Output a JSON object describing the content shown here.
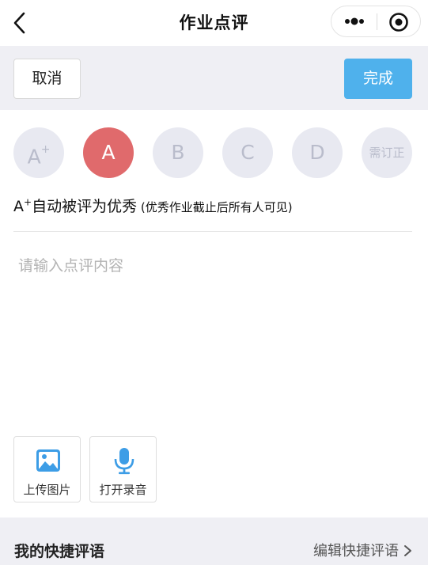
{
  "nav": {
    "title": "作业点评"
  },
  "actions": {
    "cancel_label": "取消",
    "done_label": "完成"
  },
  "grades": [
    {
      "label": "A",
      "sup": "+",
      "selected": false
    },
    {
      "label": "A",
      "sup": "",
      "selected": true
    },
    {
      "label": "B",
      "sup": "",
      "selected": false
    },
    {
      "label": "C",
      "sup": "",
      "selected": false
    },
    {
      "label": "D",
      "sup": "",
      "selected": false
    },
    {
      "label": "需订正",
      "sup": "",
      "selected": false
    }
  ],
  "note": {
    "prefix": "A",
    "prefix_sup": "+",
    "main": "自动被评为优秀",
    "sub": " (优秀作业截止后所有人可见)"
  },
  "comment": {
    "placeholder": "请输入点评内容",
    "value": ""
  },
  "tools": {
    "upload_label": "上传图片",
    "record_label": "打开录音"
  },
  "quick": {
    "title": "我的快捷评语",
    "edit_label": "编辑快捷评语"
  },
  "colors": {
    "primary": "#4fb1ec",
    "selected_grade": "#e06a6c",
    "grade_bg": "#e8e9f1",
    "grade_text": "#b9bccb"
  },
  "icons": [
    "back-arrow-icon",
    "more-dots-icon",
    "target-icon",
    "image-icon",
    "microphone-icon",
    "chevron-right-icon"
  ]
}
